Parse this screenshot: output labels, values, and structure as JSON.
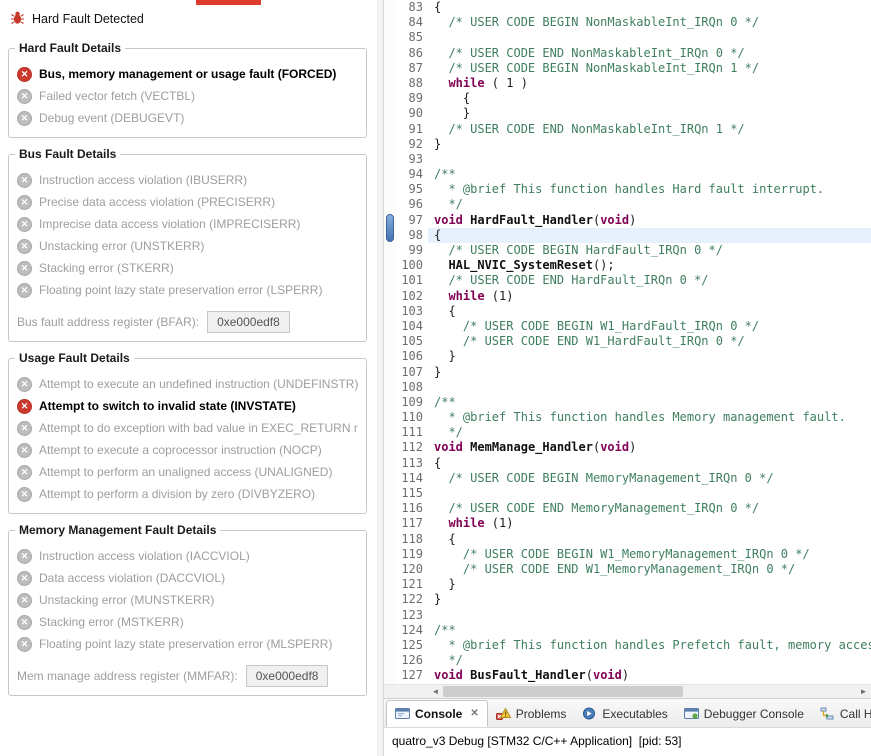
{
  "colors": {
    "fault_active": "#cc3a2e",
    "fault_inactive": "#bdbdbd",
    "keyword": "#7f0055",
    "comment": "#3f7f5f",
    "current_line": "#e7f1fd",
    "red_fragment": "#dd3c2c"
  },
  "fault_analyzer": {
    "title": "Hard Fault Detected",
    "groups": [
      {
        "title": "Hard Fault Details",
        "items": [
          {
            "label": "Bus, memory management or usage fault (FORCED)",
            "active": true
          },
          {
            "label": "Failed vector fetch (VECTBL)",
            "active": false
          },
          {
            "label": "Debug event (DEBUGEVT)",
            "active": false
          }
        ]
      },
      {
        "title": "Bus Fault Details",
        "items": [
          {
            "label": "Instruction access violation (IBUSERR)",
            "active": false
          },
          {
            "label": "Precise data access violation (PRECISERR)",
            "active": false
          },
          {
            "label": "Imprecise data access violation (IMPRECISERR)",
            "active": false
          },
          {
            "label": "Unstacking error (UNSTKERR)",
            "active": false
          },
          {
            "label": "Stacking error (STKERR)",
            "active": false
          },
          {
            "label": "Floating point lazy state preservation error (LSPERR)",
            "active": false
          }
        ],
        "field": {
          "label": "Bus fault address register (BFAR):",
          "value": "0xe000edf8"
        }
      },
      {
        "title": "Usage Fault Details",
        "items": [
          {
            "label": "Attempt to execute an undefined instruction (UNDEFINSTR)",
            "active": false
          },
          {
            "label": "Attempt to switch to invalid state (INVSTATE)",
            "active": true
          },
          {
            "label": "Attempt to do exception with bad value in EXEC_RETURN number (INVPC)",
            "active": false
          },
          {
            "label": "Attempt to execute a coprocessor instruction (NOCP)",
            "active": false
          },
          {
            "label": "Attempt to perform an unaligned access (UNALIGNED)",
            "active": false
          },
          {
            "label": "Attempt to perform a division by zero (DIVBYZERO)",
            "active": false
          }
        ]
      },
      {
        "title": "Memory Management Fault Details",
        "items": [
          {
            "label": "Instruction access violation (IACCVIOL)",
            "active": false
          },
          {
            "label": "Data access violation (DACCVIOL)",
            "active": false
          },
          {
            "label": "Unstacking error (MUNSTKERR)",
            "active": false
          },
          {
            "label": "Stacking error (MSTKERR)",
            "active": false
          },
          {
            "label": "Floating point lazy state preservation error (MLSPERR)",
            "active": false
          }
        ],
        "field": {
          "label": "Mem manage address register (MMFAR):",
          "value": "0xe000edf8"
        }
      }
    ]
  },
  "editor": {
    "current_line": 98,
    "lines": [
      {
        "num": 83,
        "seg": [
          [
            "{",
            "p"
          ]
        ]
      },
      {
        "num": 84,
        "seg": [
          [
            "  /* USER CODE BEGIN NonMaskableInt_IRQn 0 */",
            "c"
          ]
        ]
      },
      {
        "num": 85,
        "seg": []
      },
      {
        "num": 86,
        "seg": [
          [
            "  /* USER CODE END NonMaskableInt_IRQn 0 */",
            "c"
          ]
        ]
      },
      {
        "num": 87,
        "seg": [
          [
            "  /* USER CODE BEGIN NonMaskableInt_IRQn 1 */",
            "c"
          ]
        ]
      },
      {
        "num": 88,
        "seg": [
          [
            "  ",
            "p"
          ],
          [
            "while",
            "k"
          ],
          [
            " ( 1 )",
            "p"
          ]
        ]
      },
      {
        "num": 89,
        "seg": [
          [
            "    {",
            "p"
          ]
        ]
      },
      {
        "num": 90,
        "seg": [
          [
            "    }",
            "p"
          ]
        ]
      },
      {
        "num": 91,
        "seg": [
          [
            "  /* USER CODE END NonMaskableInt_IRQn 1 */",
            "c"
          ]
        ]
      },
      {
        "num": 92,
        "seg": [
          [
            "}",
            "p"
          ]
        ]
      },
      {
        "num": 93,
        "seg": []
      },
      {
        "num": 94,
        "seg": [
          [
            "/**",
            "c"
          ]
        ]
      },
      {
        "num": 95,
        "seg": [
          [
            "  * @brief This function handles Hard fault interrupt.",
            "c"
          ]
        ]
      },
      {
        "num": 96,
        "seg": [
          [
            "  */",
            "c"
          ]
        ]
      },
      {
        "num": 97,
        "seg": [
          [
            "void",
            "k"
          ],
          [
            " ",
            "p"
          ],
          [
            "HardFault_Handler",
            "f"
          ],
          [
            "(",
            "p"
          ],
          [
            "void",
            "k"
          ],
          [
            ")",
            "p"
          ]
        ]
      },
      {
        "num": 98,
        "seg": [
          [
            "{",
            "p"
          ]
        ]
      },
      {
        "num": 99,
        "seg": [
          [
            "  /* USER CODE BEGIN HardFault_IRQn 0 */",
            "c"
          ]
        ]
      },
      {
        "num": 100,
        "seg": [
          [
            "  ",
            "p"
          ],
          [
            "HAL_NVIC_SystemReset",
            "f"
          ],
          [
            "();",
            "p"
          ]
        ]
      },
      {
        "num": 101,
        "seg": [
          [
            "  /* USER CODE END HardFault_IRQn 0 */",
            "c"
          ]
        ]
      },
      {
        "num": 102,
        "seg": [
          [
            "  ",
            "p"
          ],
          [
            "while",
            "k"
          ],
          [
            " (1)",
            "p"
          ]
        ]
      },
      {
        "num": 103,
        "seg": [
          [
            "  {",
            "p"
          ]
        ]
      },
      {
        "num": 104,
        "seg": [
          [
            "    /* USER CODE BEGIN W1_HardFault_IRQn 0 */",
            "c"
          ]
        ]
      },
      {
        "num": 105,
        "seg": [
          [
            "    /* USER CODE END W1_HardFault_IRQn 0 */",
            "c"
          ]
        ]
      },
      {
        "num": 106,
        "seg": [
          [
            "  }",
            "p"
          ]
        ]
      },
      {
        "num": 107,
        "seg": [
          [
            "}",
            "p"
          ]
        ]
      },
      {
        "num": 108,
        "seg": []
      },
      {
        "num": 109,
        "seg": [
          [
            "/**",
            "c"
          ]
        ]
      },
      {
        "num": 110,
        "seg": [
          [
            "  * @brief This function handles Memory management fault.",
            "c"
          ]
        ]
      },
      {
        "num": 111,
        "seg": [
          [
            "  */",
            "c"
          ]
        ]
      },
      {
        "num": 112,
        "seg": [
          [
            "void",
            "k"
          ],
          [
            " ",
            "p"
          ],
          [
            "MemManage_Handler",
            "f"
          ],
          [
            "(",
            "p"
          ],
          [
            "void",
            "k"
          ],
          [
            ")",
            "p"
          ]
        ]
      },
      {
        "num": 113,
        "seg": [
          [
            "{",
            "p"
          ]
        ]
      },
      {
        "num": 114,
        "seg": [
          [
            "  /* USER CODE BEGIN MemoryManagement_IRQn 0 */",
            "c"
          ]
        ]
      },
      {
        "num": 115,
        "seg": []
      },
      {
        "num": 116,
        "seg": [
          [
            "  /* USER CODE END MemoryManagement_IRQn 0 */",
            "c"
          ]
        ]
      },
      {
        "num": 117,
        "seg": [
          [
            "  ",
            "p"
          ],
          [
            "while",
            "k"
          ],
          [
            " (1)",
            "p"
          ]
        ]
      },
      {
        "num": 118,
        "seg": [
          [
            "  {",
            "p"
          ]
        ]
      },
      {
        "num": 119,
        "seg": [
          [
            "    /* USER CODE BEGIN W1_MemoryManagement_IRQn 0 */",
            "c"
          ]
        ]
      },
      {
        "num": 120,
        "seg": [
          [
            "    /* USER CODE END W1_MemoryManagement_IRQn 0 */",
            "c"
          ]
        ]
      },
      {
        "num": 121,
        "seg": [
          [
            "  }",
            "p"
          ]
        ]
      },
      {
        "num": 122,
        "seg": [
          [
            "}",
            "p"
          ]
        ]
      },
      {
        "num": 123,
        "seg": []
      },
      {
        "num": 124,
        "seg": [
          [
            "/**",
            "c"
          ]
        ]
      },
      {
        "num": 125,
        "seg": [
          [
            "  * @brief This function handles Prefetch fault, memory access fault.",
            "c"
          ]
        ]
      },
      {
        "num": 126,
        "seg": [
          [
            "  */",
            "c"
          ]
        ]
      },
      {
        "num": 127,
        "seg": [
          [
            "void",
            "k"
          ],
          [
            " ",
            "p"
          ],
          [
            "BusFault_Handler",
            "f"
          ],
          [
            "(",
            "p"
          ],
          [
            "void",
            "k"
          ],
          [
            ")",
            "p"
          ]
        ]
      }
    ]
  },
  "bottom_tabs": [
    {
      "label": "Console",
      "icon": "console-icon",
      "active": true,
      "closable": true
    },
    {
      "label": "Problems",
      "icon": "problems-icon",
      "active": false,
      "closable": false
    },
    {
      "label": "Executables",
      "icon": "executables-icon",
      "active": false,
      "closable": false
    },
    {
      "label": "Debugger Console",
      "icon": "debugger-console-icon",
      "active": false,
      "closable": false
    },
    {
      "label": "Call Hierarchy",
      "icon": "call-hierarchy-icon",
      "active": false,
      "closable": false
    }
  ],
  "console": {
    "header": "quatro_v3 Debug [STM32 C/C++ Application]  [pid: 53]"
  }
}
